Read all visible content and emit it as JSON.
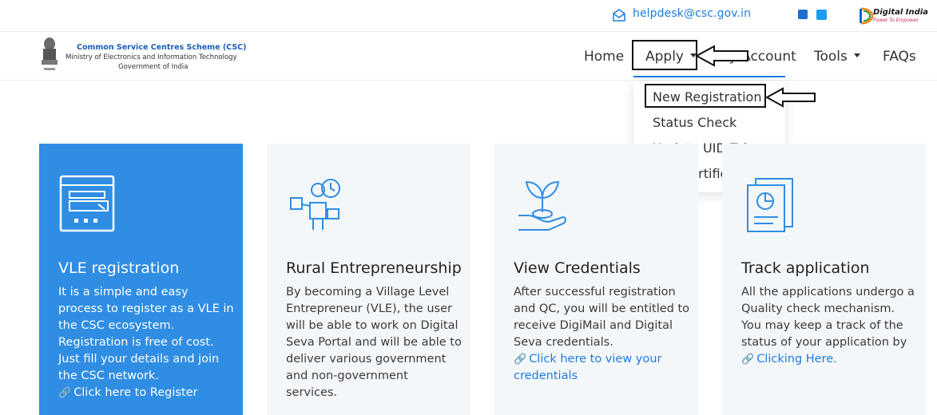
{
  "topbar": {
    "email": "helpdesk@csc.gov.in",
    "digital_india_title": "Digital India",
    "digital_india_sub": "Power To Empower"
  },
  "brand": {
    "line1": "Common Service Centres Scheme (CSC)",
    "line2": "Ministry of Electronics and Information Technology",
    "line3": "Government of India"
  },
  "nav": {
    "home": "Home",
    "apply": "Apply",
    "my_account": "My Account",
    "tools": "Tools",
    "faqs": "FAQs"
  },
  "apply_menu": {
    "items": [
      "New Registration",
      "Status Check",
      "Update UID Token",
      "TEC Certificate"
    ]
  },
  "cards": [
    {
      "title": "VLE registration",
      "body": "It is a simple and easy process to register as a VLE in the CSC ecosystem. Registration is free of cost. Just fill your details and join the CSC network.",
      "link": "Click here to Register"
    },
    {
      "title": "Rural Entrepreneurship",
      "body": "By becoming a Village Level Entrepreneur (VLE), the user will be able to work on Digital Seva Portal and will be able to deliver various government and non-government services.",
      "link": ""
    },
    {
      "title": "View Credentials",
      "body": "After successful registration and QC, you will be entitled to receive DigiMail and Digital Seva credentials.",
      "link": "Click here to view your credentials"
    },
    {
      "title": "Track application",
      "body": "All the applications undergo a Quality check mechanism. You may keep a track of the status of your application by",
      "link": "Clicking Here."
    }
  ],
  "colors": {
    "accent": "#1d7bdc",
    "card_blue": "#2f8de4",
    "card_light": "#f4f7fa"
  }
}
